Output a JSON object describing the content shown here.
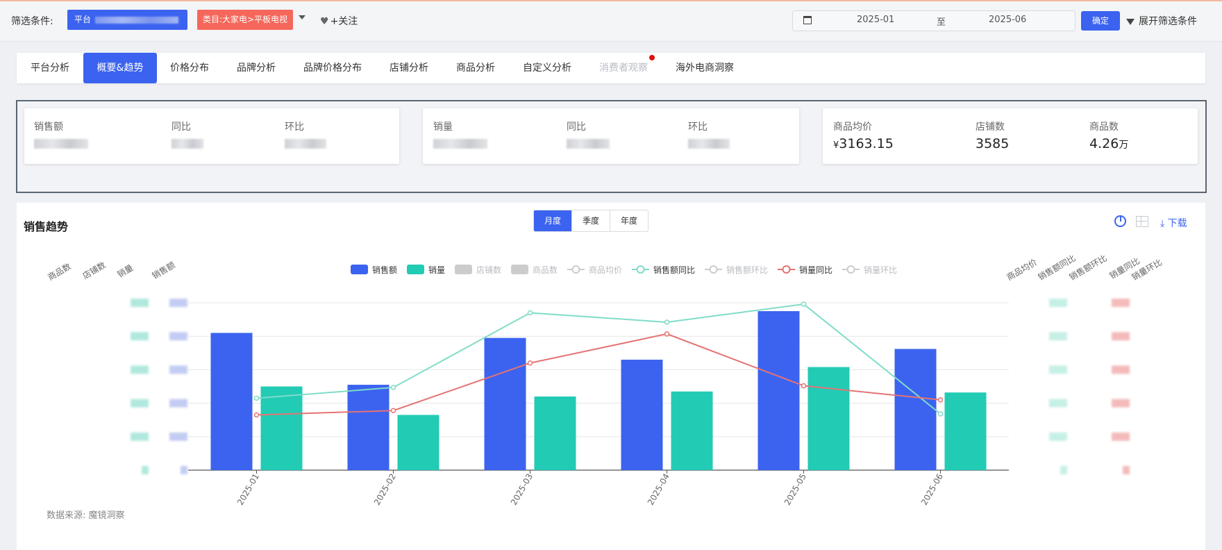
{
  "filter": {
    "label": "筛选条件:",
    "platform_tag": "平台",
    "category_tag": "类目:大家电>平板电视",
    "follow_label": "+关注",
    "date_start": "2025-01",
    "date_to": "至",
    "date_end": "2025-06",
    "confirm_label": "确定",
    "expand_label": "展开筛选条件"
  },
  "tabs": [
    {
      "label": "平台分析",
      "state": "normal"
    },
    {
      "label": "概要&趋势",
      "state": "active"
    },
    {
      "label": "价格分布",
      "state": "normal"
    },
    {
      "label": "品牌分析",
      "state": "normal"
    },
    {
      "label": "品牌价格分布",
      "state": "normal"
    },
    {
      "label": "店铺分析",
      "state": "normal"
    },
    {
      "label": "商品分析",
      "state": "normal"
    },
    {
      "label": "自定义分析",
      "state": "normal"
    },
    {
      "label": "消费者观察",
      "state": "disabled"
    },
    {
      "label": "海外电商洞察",
      "state": "normal"
    }
  ],
  "kpi": {
    "card1": {
      "labels": [
        "销售额",
        "同比",
        "环比"
      ]
    },
    "card2": {
      "labels": [
        "销量",
        "同比",
        "环比"
      ]
    },
    "card3": {
      "labels": [
        "商品均价",
        "店铺数",
        "商品数"
      ],
      "avg_price_prefix": "¥",
      "avg_price": "3163.15",
      "shop_count": "3585",
      "product_count": "4.26",
      "product_unit": "万"
    }
  },
  "trend": {
    "title": "销售趋势",
    "periods": [
      "月度",
      "季度",
      "年度"
    ],
    "active_period": "月度",
    "download_label": "下载",
    "source": "数据来源: 魔镜洞察",
    "left_axis_titles": [
      "商品数",
      "店铺数",
      "销量",
      "销售额"
    ],
    "right_axis_titles": [
      "商品均价",
      "销售额同比",
      "销售额环比",
      "销量同比",
      "销量环比"
    ]
  },
  "chart_data": {
    "type": "bar",
    "categories": [
      "2025-01",
      "2025-02",
      "2025-03",
      "2025-04",
      "2025-05",
      "2025-06"
    ],
    "ylim": [
      0,
      5
    ],
    "grid": true,
    "legend_position": "top-center",
    "legend": [
      {
        "name": "销售额",
        "kind": "bar",
        "active": true,
        "color": "#3b63f0"
      },
      {
        "name": "销量",
        "kind": "bar",
        "active": true,
        "color": "#22cbb4"
      },
      {
        "name": "店铺数",
        "kind": "bar",
        "active": false,
        "color": "#cccccc"
      },
      {
        "name": "商品数",
        "kind": "bar",
        "active": false,
        "color": "#cccccc"
      },
      {
        "name": "商品均价",
        "kind": "line",
        "active": false,
        "color": "#cccccc"
      },
      {
        "name": "销售额同比",
        "kind": "line",
        "active": true,
        "color": "#7fdcc9"
      },
      {
        "name": "销售额环比",
        "kind": "line",
        "active": false,
        "color": "#cccccc"
      },
      {
        "name": "销量同比",
        "kind": "line",
        "active": true,
        "color": "#e57373"
      },
      {
        "name": "销量环比",
        "kind": "line",
        "active": false,
        "color": "#cccccc"
      }
    ],
    "series": [
      {
        "name": "销售额",
        "type": "bar",
        "color": "#3b63f0",
        "values": [
          4.1,
          2.55,
          3.95,
          3.3,
          4.75,
          3.62
        ]
      },
      {
        "name": "销量",
        "type": "bar",
        "color": "#22cbb4",
        "values": [
          2.5,
          1.65,
          2.2,
          2.35,
          3.08,
          2.32
        ]
      },
      {
        "name": "销售额同比",
        "type": "line",
        "color": "#7fdcc9",
        "values": [
          2.15,
          2.47,
          4.7,
          4.42,
          4.96,
          1.68
        ]
      },
      {
        "name": "销量同比",
        "type": "line",
        "color": "#e57373",
        "values": [
          1.65,
          1.78,
          3.2,
          4.07,
          2.52,
          2.1
        ]
      }
    ]
  }
}
